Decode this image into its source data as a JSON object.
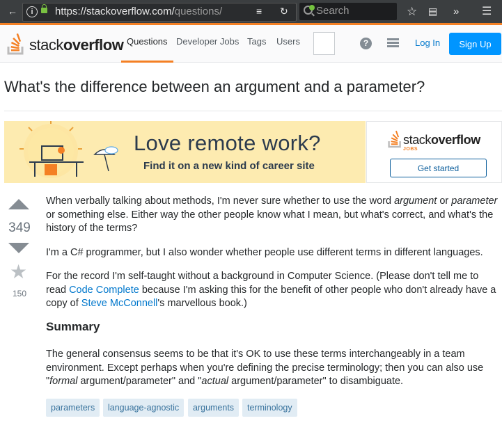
{
  "browser": {
    "url_main": "https://stackoverflow.com/",
    "url_rest": "questions/",
    "search_placeholder": "Search"
  },
  "header": {
    "logo_light": "stack",
    "logo_bold": "overflow",
    "nav": [
      "Questions",
      "Developer Jobs",
      "Tags",
      "Users"
    ],
    "help_glyph": "?",
    "login": "Log In",
    "signup": "Sign Up"
  },
  "question": {
    "title": "What's the difference between an argument and a parameter?",
    "votes": "349",
    "favorites": "150",
    "summary_heading": "Summary",
    "tags": [
      "parameters",
      "language-agnostic",
      "arguments",
      "terminology"
    ]
  },
  "ad": {
    "headline": "Love remote work?",
    "subline": "Find it on a new kind of career site",
    "logo_light": "stack",
    "logo_bold": "overflow",
    "jobs_label": "JOBS",
    "cta": "Get started"
  },
  "body": {
    "p1_l1_a": "When verbally talking about methods, I'm never sure whether to use the word ",
    "p1_l1_em1": "argument",
    "p1_l1_b": " or ",
    "p1_l1_em2": "parameter",
    "p1_l2": "or something else. Either way the other people know what I mean, but what's correct, and what's the",
    "p1_l3": "history of the terms?",
    "p2": "I'm a C# programmer, but I also wonder whether people use different terms in different languages.",
    "p3_l1": "For the record I'm self-taught without a background in Computer Science. (Please don't tell me to",
    "p3_l2_a": "read ",
    "p3_l2_link": "Code Complete",
    "p3_l2_b": " because I'm asking this for the benefit of other people who don't already have a",
    "p3_l3_a": "copy of ",
    "p3_l3_link": "Steve McConnell",
    "p3_l3_b": "'s marvellous book.)",
    "p4_l1": "The general consensus seems to be that it's OK to use these terms interchangeably in a team",
    "p4_l2": "environment. Except perhaps when you're defining the precise terminology; then you can also use",
    "p4_l3_a": "\"",
    "p4_l3_em1": "formal",
    "p4_l3_b": " argument/parameter\" and \"",
    "p4_l3_em2": "actual",
    "p4_l3_c": " argument/parameter\" to disambiguate."
  },
  "colors": {
    "accent": "#f48024",
    "link": "#0077cc",
    "signup_bg": "#0095ff",
    "tag_bg": "#e1ecf4"
  }
}
